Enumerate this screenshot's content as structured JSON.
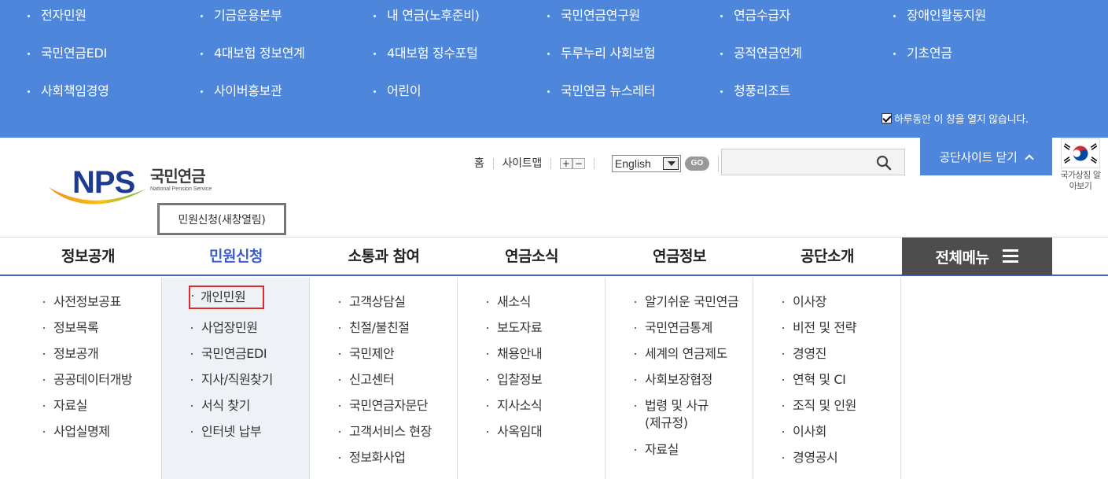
{
  "family_sites": {
    "rows": [
      [
        "전자민원",
        "기금운용본부",
        "내 연금(노후준비)",
        "국민연금연구원",
        "연금수급자",
        "장애인활동지원"
      ],
      [
        "국민연금EDI",
        "4대보험 정보연계",
        "4대보험 징수포털",
        "두루누리 사회보험",
        "공적연금연계",
        "기초연금"
      ],
      [
        "사회책임경영",
        "사이버홍보관",
        "어린이",
        "국민연금 뉴스레터",
        "청풍리조트"
      ]
    ],
    "no_show_today": "하루동안 이 창을 열지 않습니다."
  },
  "header": {
    "logo": {
      "abbr": "NPS",
      "name_kr": "국민연금",
      "name_en": "National Pension Service"
    },
    "popup_button": "민원신청(새창열림)",
    "util": {
      "home": "홈",
      "sitemap": "사이트맵",
      "zoom_in": "+",
      "zoom_out": "−",
      "language": "English",
      "go": "GO"
    },
    "search": {
      "placeholder": ""
    },
    "close_site": "공단사이트 닫기",
    "national_symbol": "국가상징 알아보기"
  },
  "gnb": {
    "items": [
      "정보공개",
      "민원신청",
      "소통과 참여",
      "연금소식",
      "연금정보",
      "공단소개"
    ],
    "active_index": 1,
    "all_menu": "전체메뉴"
  },
  "mega_menu": {
    "columns": [
      [
        "사전정보공표",
        "정보목록",
        "정보공개",
        "공공데이터개방",
        "자료실",
        "사업실명제"
      ],
      [
        "개인민원",
        "사업장민원",
        "국민연금EDI",
        "지사/직원찾기",
        "서식 찾기",
        "인터넷 납부"
      ],
      [
        "고객상담실",
        "친절/불친절",
        "국민제안",
        "신고센터",
        "국민연금자문단",
        "고객서비스 현장",
        "정보화사업"
      ],
      [
        "새소식",
        "보도자료",
        "채용안내",
        "입찰정보",
        "지사소식",
        "사옥임대"
      ],
      [
        "알기쉬운 국민연금",
        "국민연금통계",
        "세계의 연금제도",
        "사회보장협정",
        "법령 및 사규(제규정)",
        "자료실"
      ],
      [
        "이사장",
        "비전 및 전략",
        "경영진",
        "연혁 및 CI",
        "조직 및 인원",
        "이사회",
        "경영공시"
      ]
    ],
    "highlighted": "개인민원"
  },
  "colors": {
    "primary_blue": "#4e86dc",
    "nav_active": "#3d5ec9",
    "all_menu_bg": "#4d4d4d",
    "highlight_border": "#e02a2a",
    "logo_navy": "#1d3b93"
  }
}
